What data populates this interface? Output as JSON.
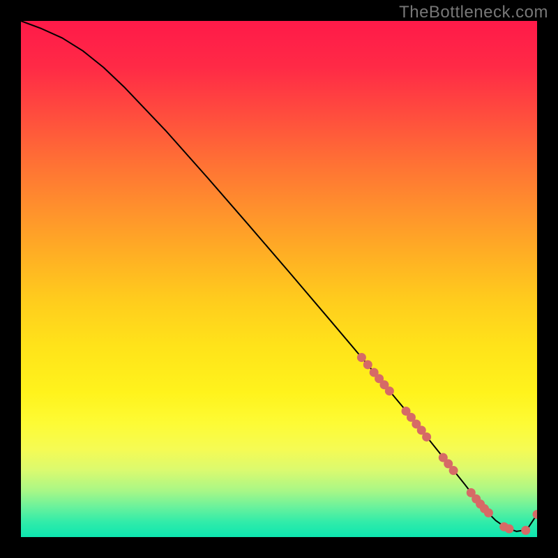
{
  "watermark": "TheBottleneck.com",
  "colors": {
    "curve": "#000000",
    "dot_fill": "#d66a66",
    "dot_stroke": "#9c3a38"
  },
  "chart_data": {
    "type": "line",
    "title": "",
    "xlabel": "",
    "ylabel": "",
    "xlim": [
      0,
      100
    ],
    "ylim": [
      0,
      100
    ],
    "series": [
      {
        "name": "curve",
        "x": [
          0,
          4,
          8,
          12,
          16,
          20,
          28,
          36,
          44,
          52,
          60,
          66,
          70,
          74,
          78,
          82,
          86,
          88,
          90,
          92,
          94,
          96,
          98,
          100
        ],
        "y": [
          100,
          98.5,
          96.7,
          94.2,
          91.0,
          87.2,
          78.8,
          69.8,
          60.6,
          51.3,
          41.9,
          34.8,
          30.0,
          25.2,
          20.2,
          15.2,
          10.2,
          7.6,
          5.2,
          3.2,
          1.8,
          1.1,
          1.4,
          4.4
        ]
      }
    ],
    "dots": [
      {
        "x": 66.0,
        "y": 34.8
      },
      {
        "x": 67.2,
        "y": 33.4
      },
      {
        "x": 68.4,
        "y": 31.9
      },
      {
        "x": 69.4,
        "y": 30.7
      },
      {
        "x": 70.4,
        "y": 29.5
      },
      {
        "x": 71.4,
        "y": 28.3
      },
      {
        "x": 74.6,
        "y": 24.4
      },
      {
        "x": 75.6,
        "y": 23.2
      },
      {
        "x": 76.6,
        "y": 21.9
      },
      {
        "x": 77.6,
        "y": 20.7
      },
      {
        "x": 78.6,
        "y": 19.4
      },
      {
        "x": 81.8,
        "y": 15.4
      },
      {
        "x": 82.8,
        "y": 14.2
      },
      {
        "x": 83.8,
        "y": 12.9
      },
      {
        "x": 87.2,
        "y": 8.6
      },
      {
        "x": 88.2,
        "y": 7.4
      },
      {
        "x": 89.0,
        "y": 6.4
      },
      {
        "x": 89.8,
        "y": 5.5
      },
      {
        "x": 90.6,
        "y": 4.7
      },
      {
        "x": 93.6,
        "y": 2.0
      },
      {
        "x": 94.6,
        "y": 1.6
      },
      {
        "x": 97.8,
        "y": 1.3
      },
      {
        "x": 100.0,
        "y": 4.4
      }
    ]
  }
}
